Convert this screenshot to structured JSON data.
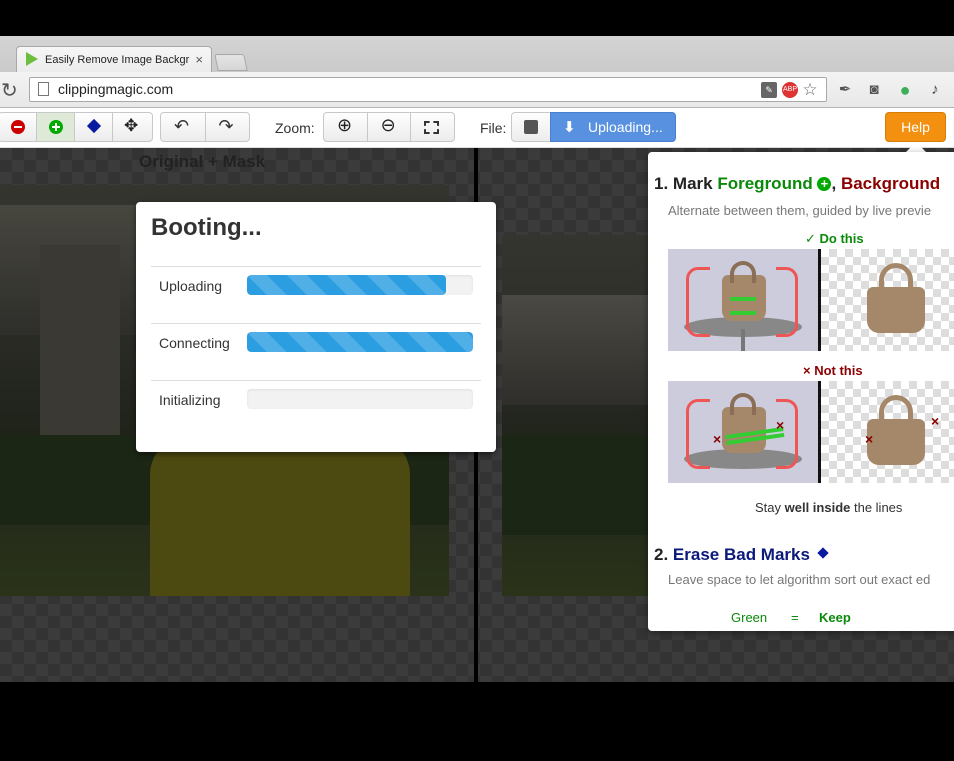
{
  "browser": {
    "tab_title": "Easily Remove Image Backgr",
    "tab_close": "×",
    "url": "clippingmagic.com",
    "reload_glyph": "↻"
  },
  "toolbar": {
    "zoom_label": "Zoom:",
    "file_label": "File:",
    "upload_label": "Uploading...",
    "help_label": "Help"
  },
  "workspace": {
    "left_pane_label": "Original + Mask"
  },
  "dialog": {
    "title": "Booting...",
    "steps": [
      {
        "label": "Uploading",
        "progress": 0.88
      },
      {
        "label": "Connecting",
        "progress": 1.0
      },
      {
        "label": "Initializing",
        "progress": 0.0
      }
    ]
  },
  "help": {
    "step1_number": "1.",
    "step1_mark": "Mark",
    "step1_fg": "Foreground",
    "step1_comma": ",",
    "step1_bg": "Background",
    "step1_sub": "Alternate between them, guided by live previe",
    "do_this": "✓ Do this",
    "not_this": "× Not this",
    "stay_pre": "Stay ",
    "stay_bold": "well inside",
    "stay_post": " the lines",
    "step2_number": "2.",
    "step2_title": "Erase Bad Marks",
    "step2_sub": "Leave space to let algorithm sort out exact ed",
    "legend_color": "Green",
    "legend_eq": "=",
    "legend_value": "Keep"
  },
  "colors": {
    "accent_blue": "#5891e0",
    "help_orange": "#f3900f",
    "progress_blue": "#2a9ee0",
    "foreground_green": "#0a8a0a",
    "background_red": "#8b0000"
  }
}
